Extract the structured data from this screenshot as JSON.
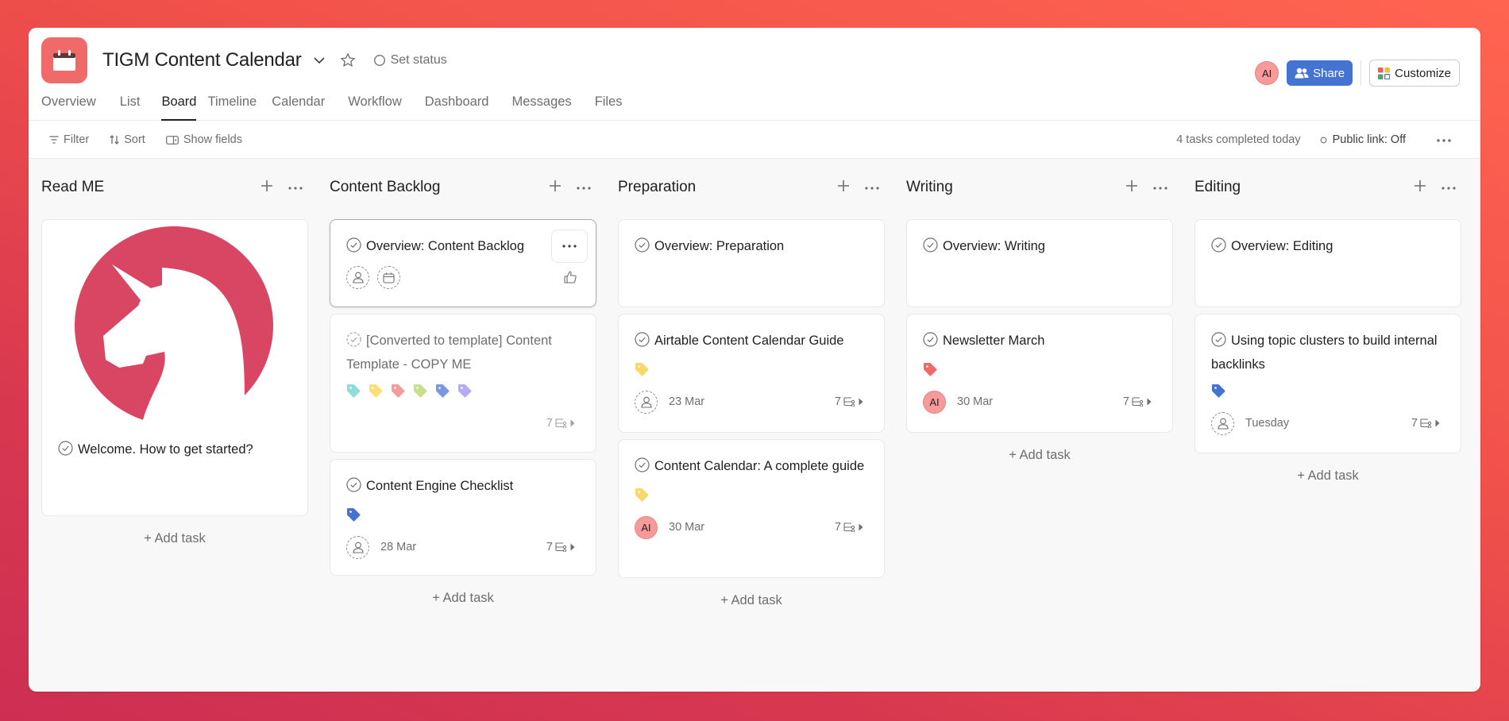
{
  "project": {
    "title": "TIGM Content Calendar",
    "icon": "calendar-icon",
    "icon_color": "#f06a6a",
    "set_status_label": "Set status"
  },
  "tabs": [
    {
      "label": "Overview",
      "active": false
    },
    {
      "label": "List",
      "active": false
    },
    {
      "label": "Board",
      "active": true
    },
    {
      "label": "Timeline",
      "active": false
    },
    {
      "label": "Calendar",
      "active": false
    },
    {
      "label": "Workflow",
      "active": false
    },
    {
      "label": "Dashboard",
      "active": false
    },
    {
      "label": "Messages",
      "active": false
    },
    {
      "label": "Files",
      "active": false
    }
  ],
  "header_right": {
    "user_initials": "AI",
    "share_label": "Share",
    "customize_label": "Customize",
    "share_color": "#4573d2"
  },
  "toolbar": {
    "filter_label": "Filter",
    "sort_label": "Sort",
    "show_fields_label": "Show fields",
    "tasks_completed": "4 tasks completed today",
    "public_link": "Public link: Off"
  },
  "add_task_label": "+ Add task",
  "columns": [
    {
      "title": "Read ME",
      "cards": [
        {
          "title": "Welcome. How to get started?",
          "cover": "unicorn-logo",
          "cover_color": "#d94663"
        }
      ]
    },
    {
      "title": "Content Backlog",
      "cards": [
        {
          "title": "Overview: Content Backlog",
          "hovered": true
        },
        {
          "title": "[Converted to template] Content Template - COPY ME",
          "muted": true,
          "tags": [
            "#8fdcd9",
            "#f8df7a",
            "#f79a9a",
            "#c7e08e",
            "#7b97e2",
            "#b3acf2"
          ],
          "subtasks": "7"
        },
        {
          "title": "Content Engine Checklist",
          "tags": [
            "#4573d2"
          ],
          "assignee": null,
          "due": "28 Mar",
          "subtasks": "7"
        }
      ]
    },
    {
      "title": "Preparation",
      "cards": [
        {
          "title": "Overview: Preparation"
        },
        {
          "title": "Airtable Content Calendar Guide",
          "tags": [
            "#f8d86a"
          ],
          "assignee": null,
          "due": "23 Mar",
          "subtasks": "7"
        },
        {
          "title": "Content Calendar: A complete guide",
          "tags": [
            "#f8d86a"
          ],
          "assignee": "AI",
          "due": "30 Mar",
          "subtasks": "7"
        }
      ]
    },
    {
      "title": "Writing",
      "cards": [
        {
          "title": "Overview: Writing"
        },
        {
          "title": "Newsletter March",
          "tags": [
            "#f06a6a"
          ],
          "assignee": "AI",
          "due": "30 Mar",
          "subtasks": "7"
        }
      ]
    },
    {
      "title": "Editing",
      "cards": [
        {
          "title": "Overview: Editing"
        },
        {
          "title": "Using topic clusters to build internal backlinks",
          "tags": [
            "#4573d2"
          ],
          "assignee": null,
          "due": "Tuesday",
          "subtasks": "7"
        }
      ]
    }
  ]
}
